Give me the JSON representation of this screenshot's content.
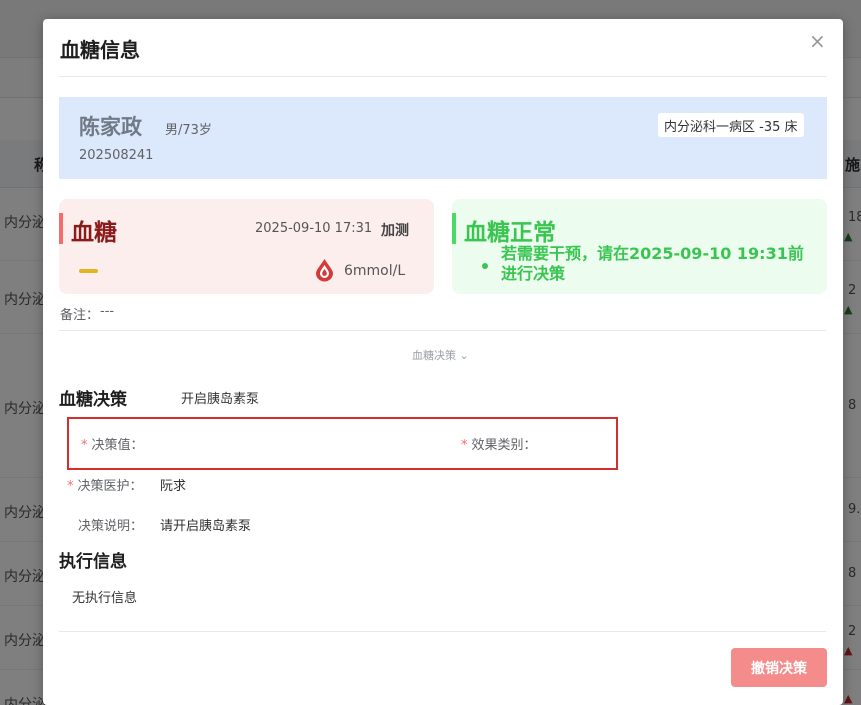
{
  "background": {
    "header_left": "称",
    "header_right": "施",
    "rows": [
      {
        "left": "内分泌",
        "right": "18"
      },
      {
        "left": "内分泌",
        "right": "2"
      },
      {
        "left": "内分泌",
        "right": "8"
      },
      {
        "left": "内分泌",
        "right": "9."
      },
      {
        "left": "内分泌",
        "right": "8"
      },
      {
        "left": "内分泌",
        "right": "2"
      },
      {
        "left": "内分泌",
        "right": ""
      }
    ]
  },
  "dialog": {
    "title": "血糖信息",
    "close": "×"
  },
  "patient": {
    "name": "陈家政",
    "sex_age": "男/73岁",
    "id": "202508241",
    "ward": "内分泌科一病区 -35 床"
  },
  "glucose_card": {
    "title": "血糖",
    "time": "2025-09-10 17:31",
    "tag": "加测",
    "value": "6mmol/L",
    "colors": {
      "accent": "#f56c6c",
      "title": "#8b1a1a",
      "dash": "#e6b422"
    }
  },
  "status_card": {
    "title": "血糖正常",
    "message": "若需要干预，请在2025-09-10 19:31前进行决策",
    "color": "#3ac551"
  },
  "note": {
    "label": "备注：",
    "value": "---"
  },
  "toggle_label": "血糖决策 ⌄",
  "decision": {
    "section_title": "血糖决策",
    "decision_text": "开启胰岛素泵",
    "value_label": "决策值：",
    "effect_label": "效果类别：",
    "nurse_label": "决策医护：",
    "nurse_value": "阮求",
    "desc_label": "决策说明：",
    "desc_value": "请开启胰岛素泵",
    "required_mark": "*"
  },
  "execution": {
    "section_title": "执行信息",
    "empty_text": "无执行信息"
  },
  "actions": {
    "cancel_decision": "撤销决策",
    "cancel_color": "#f48c8c"
  }
}
